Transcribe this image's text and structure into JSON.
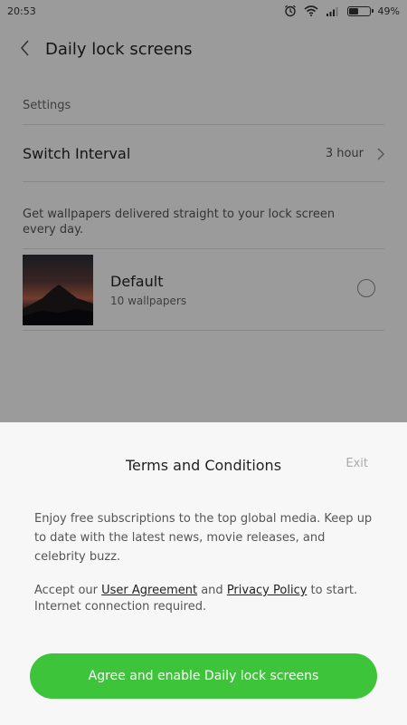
{
  "statusbar": {
    "time": "20:53",
    "battery": "49%",
    "battery_level": 0.49
  },
  "header": {
    "title": "Daily lock screens"
  },
  "settings": {
    "section_label": "Settings",
    "interval_label": "Switch Interval",
    "interval_value": "3 hour",
    "description": "Get wallpapers delivered straight to your lock screen every day."
  },
  "wallpaper": {
    "name": "Default",
    "count": "10 wallpapers"
  },
  "sheet": {
    "title": "Terms and Conditions",
    "exit": "Exit",
    "body": "Enjoy free subscriptions to the top global media. Keep up to date with the latest news, movie releases, and celebrity buzz.",
    "accept_prefix": "Accept our ",
    "user_agreement": "User Agreement",
    "and": " and ",
    "privacy_policy": "Privacy Policy",
    "accept_suffix": " to start. Internet connection required.",
    "agree_button": "Agree and enable Daily lock screens"
  },
  "colors": {
    "accent": "#3ec43a",
    "overlay": "rgba(0,0,0,0.38)"
  },
  "icons": [
    "alarm-icon",
    "wifi-icon",
    "signal-icon",
    "battery-icon",
    "back-arrow-icon",
    "chevron-right-icon"
  ]
}
